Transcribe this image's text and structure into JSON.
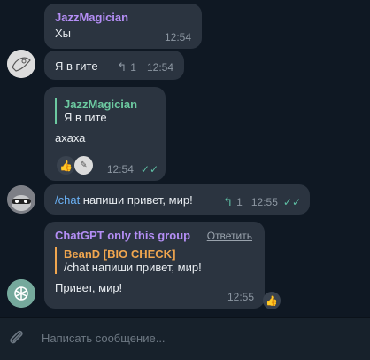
{
  "messages": [
    {
      "sender": "JazzMagician",
      "text": "Хы",
      "time": "12:54"
    },
    {
      "text": "Я в гите",
      "replies": "1",
      "time": "12:54"
    },
    {
      "sender": "JazzMagician",
      "quote_text": "Я в гите",
      "text": "ахаха",
      "time": "12:54"
    },
    {
      "command": "/chat",
      "text": " напиши привет, мир!",
      "replies": "1",
      "time": "12:55"
    },
    {
      "sender": "ChatGPT only this group",
      "reply_label": "Ответить",
      "quote_sender": "BeanD [BIO CHECK]",
      "quote_text": "/chat напиши привет, мир!",
      "text": "Привет, мир!",
      "time": "12:55"
    }
  ],
  "input": {
    "placeholder": "Написать сообщение..."
  },
  "colors": {
    "jazz": "#b48ef5",
    "quote_accent": "#6cc9a0",
    "bot_name": "#b48ef5",
    "bot_quote": "#f0a64f",
    "command": "#6ab0f3",
    "check": "#5fc0a5"
  }
}
